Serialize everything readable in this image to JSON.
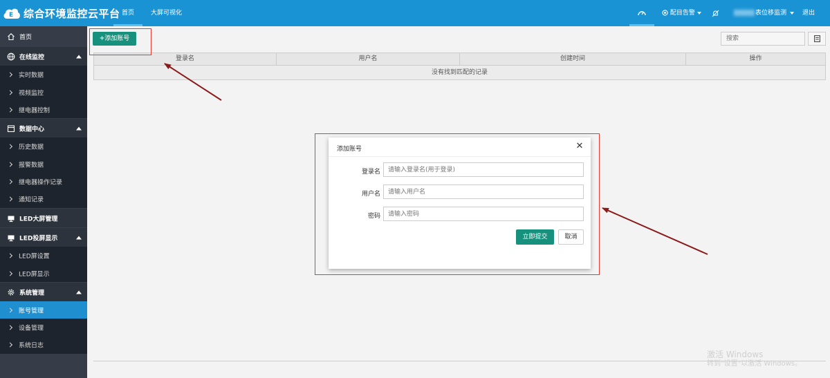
{
  "header": {
    "title": "综合环境监控云平台",
    "tabs": [
      {
        "label": "首页",
        "active": true
      },
      {
        "label": "大屏可视化",
        "active": false
      }
    ],
    "alarm_label": "配目告警",
    "user_label": "表位移监测",
    "logout_label": "退出"
  },
  "sidebar": {
    "home": "首页",
    "groups": [
      {
        "label": "在线监控",
        "items": [
          "实时数据",
          "视频监控",
          "继电器控制"
        ]
      },
      {
        "label": "数据中心",
        "items": [
          "历史数据",
          "报警数据",
          "继电器操作记录",
          "通知记录"
        ]
      },
      {
        "label": "LED大屏管理",
        "items": []
      },
      {
        "label": "LED投屏显示",
        "items": [
          "LED屏设置",
          "LED屏显示"
        ]
      },
      {
        "label": "系统管理",
        "items": [
          "账号管理",
          "设备管理",
          "系统日志"
        ]
      }
    ],
    "active_item": "账号管理"
  },
  "toolbar": {
    "add_label": "添加账号",
    "search_placeholder": "搜索"
  },
  "table": {
    "columns": [
      "登录名",
      "用户名",
      "创建时间",
      "操作"
    ],
    "empty_text": "没有找到匹配的记录"
  },
  "modal": {
    "title": "添加账号",
    "fields": [
      {
        "label": "登录名",
        "placeholder": "请输入登录名(用于登录)"
      },
      {
        "label": "用户名",
        "placeholder": "请输入用户名"
      },
      {
        "label": "密码",
        "placeholder": "请输入密码"
      }
    ],
    "submit_label": "立即提交",
    "cancel_label": "取消"
  },
  "watermark": {
    "line1": "激活 Windows",
    "line2": "转到\"设置\"以激活 Windows。"
  },
  "colors": {
    "header": "#1a93d4",
    "sidebar": "#363d48",
    "sidebar_active": "#1f8fd0",
    "primary_button": "#17917d",
    "annotation": "#e53935",
    "arrow": "#8b1a1a"
  },
  "icons": [
    "cloud-logo-icon",
    "dashboard-icon",
    "bell-icon",
    "bell-off-icon",
    "home-icon",
    "globe-icon",
    "calendar-icon",
    "monitor-icon",
    "gear-icon",
    "chevron-right-icon",
    "close-icon",
    "plus-icon",
    "columns-icon"
  ]
}
